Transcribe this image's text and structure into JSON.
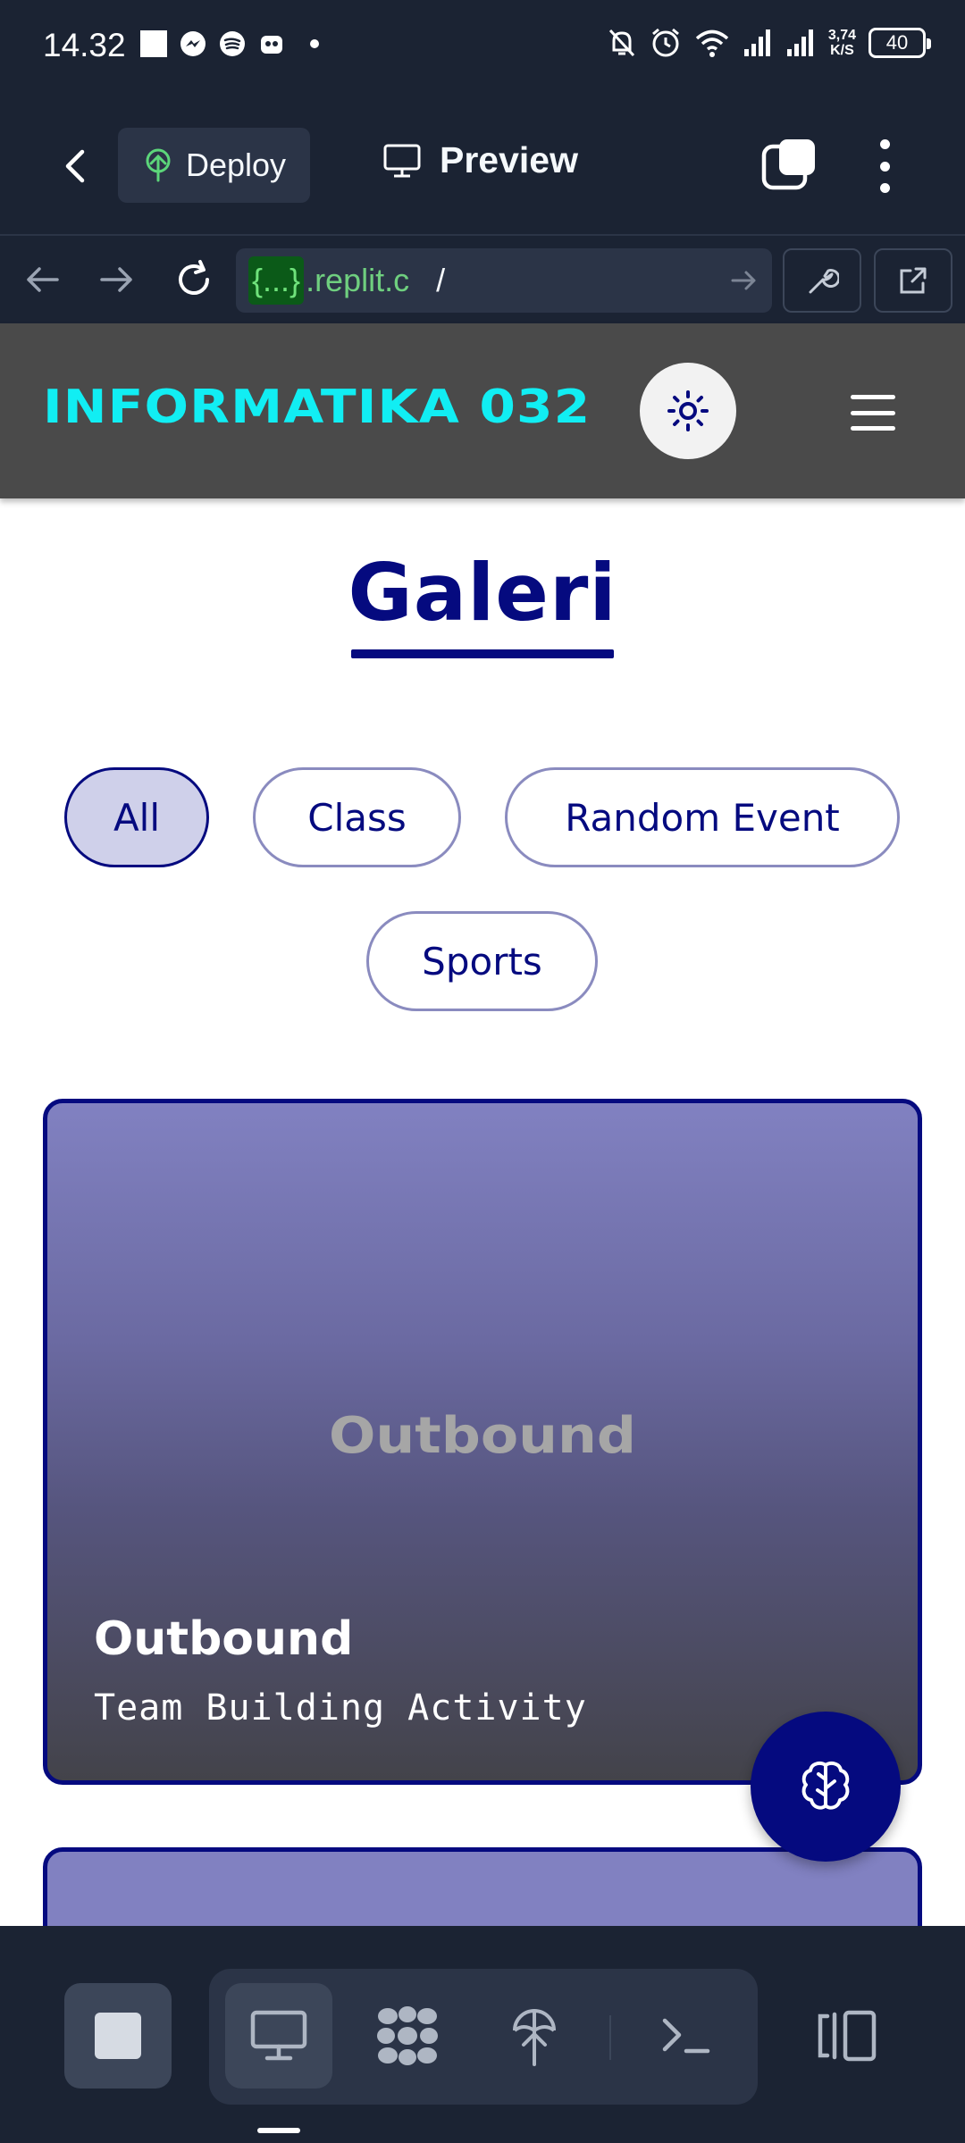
{
  "status_bar": {
    "time": "14.32",
    "net_speed_value": "3,74",
    "net_speed_unit": "K/S",
    "battery": "40"
  },
  "app_header": {
    "deploy_label": "Deploy",
    "preview_label": "Preview"
  },
  "url_bar": {
    "badge": "{...}",
    "host": ".replit.c",
    "path": "/"
  },
  "site": {
    "brand": "INFORMATIKA 032",
    "page_title": "Galeri",
    "filters": [
      "All",
      "Class",
      "Random Event",
      "Sports"
    ],
    "active_filter": "All",
    "cards": [
      {
        "placeholder": "Outbound",
        "title": "Outbound",
        "subtitle": "Team Building Activity"
      }
    ]
  },
  "colors": {
    "brand": "#11eef3",
    "accent": "#050a7f",
    "app_chrome": "#1b2333",
    "navbar": "#4a4a4a"
  },
  "icons": {
    "fab": "brain-icon",
    "theme": "sun-icon",
    "menu": "hamburger-icon"
  }
}
